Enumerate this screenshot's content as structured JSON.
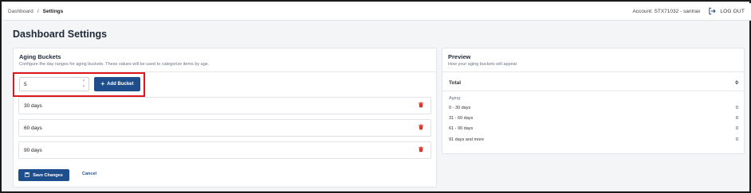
{
  "breadcrumb": {
    "root": "Dashboard",
    "separator": "/",
    "current": "Settings"
  },
  "account": {
    "label": "Account: STX71032 - santrax",
    "logout_label": "LOG OUT"
  },
  "page_title": "Dashboard Settings",
  "aging": {
    "title": "Aging Buckets",
    "subtitle": "Configure the day ranges for aging buckets. These values will be used to categorize items by age.",
    "input_value": "5",
    "add_button_label": "Add Bucket",
    "buckets": [
      {
        "label": "30 days"
      },
      {
        "label": "60 days"
      },
      {
        "label": "90 days"
      }
    ],
    "save_label": "Save Changes",
    "cancel_label": "Cancel"
  },
  "preview": {
    "title": "Preview",
    "subtitle": "How your aging buckets will appear",
    "total_label": "Total",
    "total_value": "0",
    "aging_label": "Aging:",
    "rows": [
      {
        "label": "0 - 30 days",
        "value": "0"
      },
      {
        "label": "31 - 60 days",
        "value": "0"
      },
      {
        "label": "61 - 90 days",
        "value": "0"
      },
      {
        "label": "91 days and more",
        "value": "0"
      }
    ]
  },
  "colors": {
    "primary": "#1f4e8c",
    "highlight": "#e0161e",
    "delete": "#d9342b"
  }
}
